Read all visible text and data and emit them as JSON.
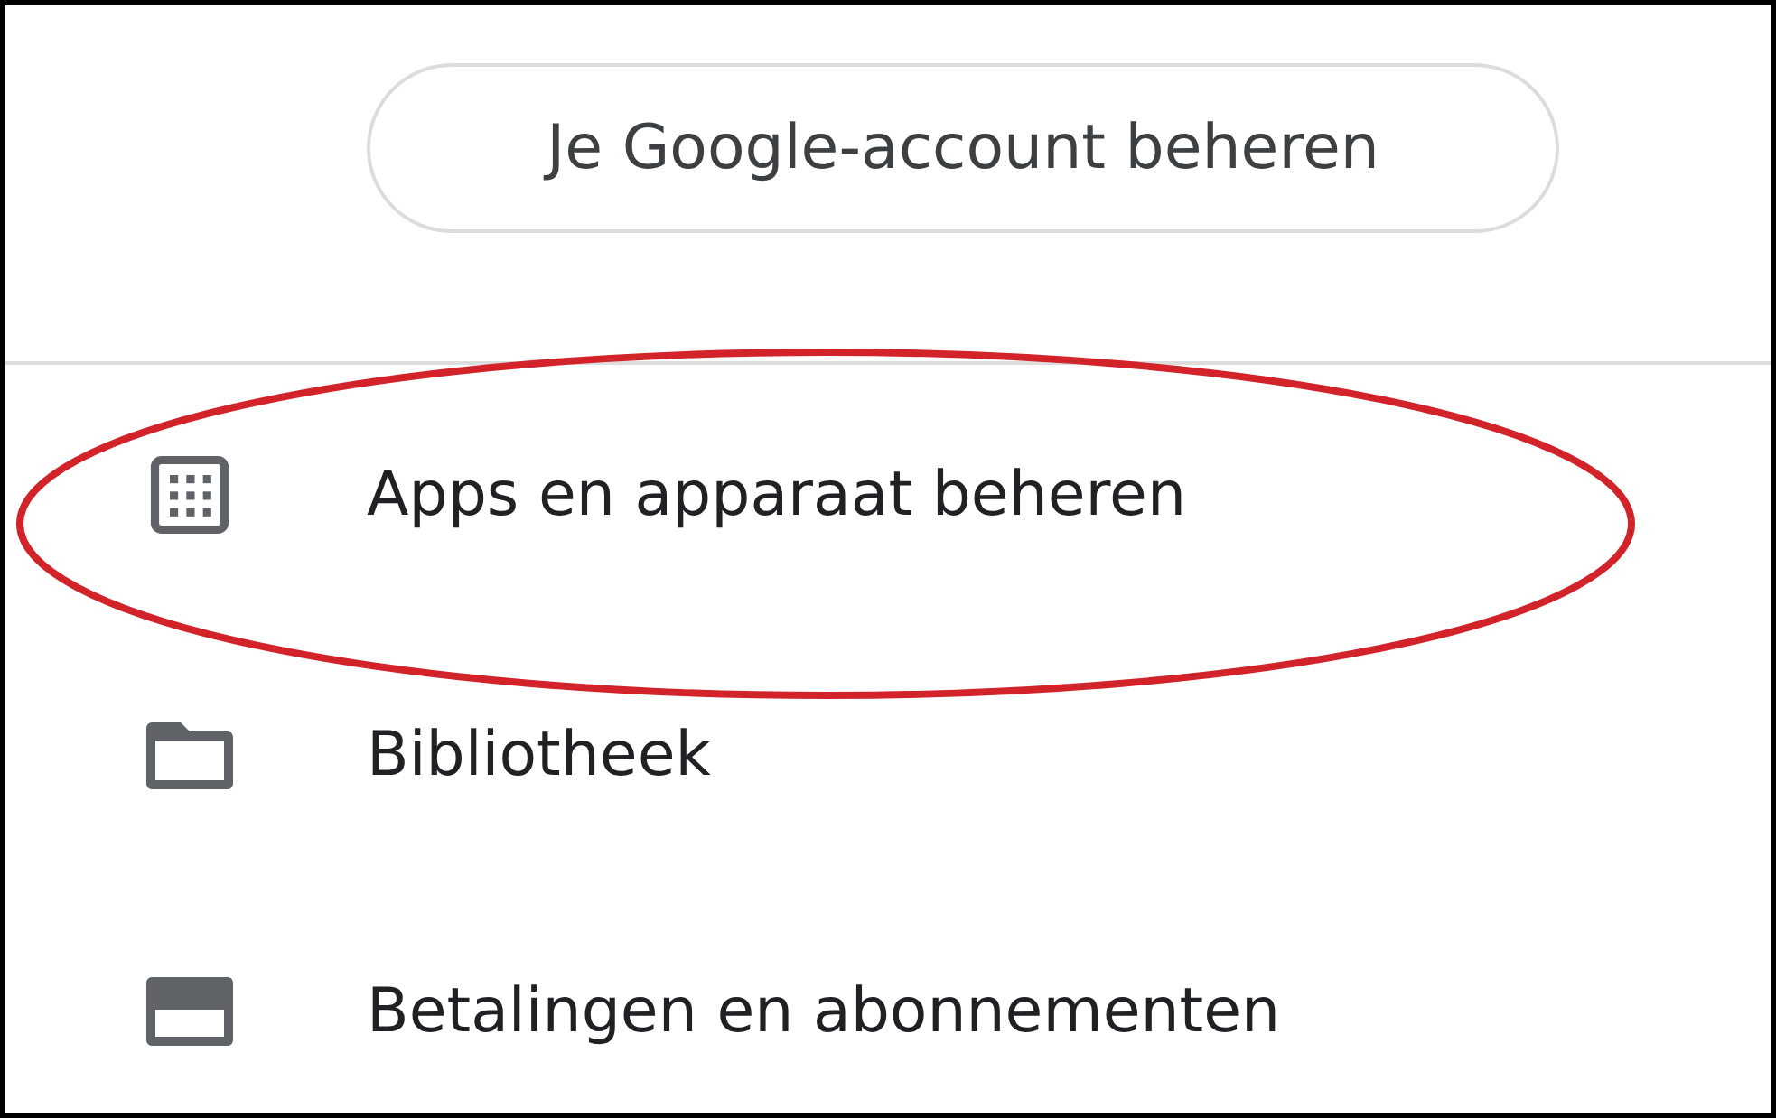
{
  "account_button": {
    "label": "Je Google-account beheren"
  },
  "menu": [
    {
      "kind": "apps",
      "label": "Apps en apparaat beheren",
      "highlighted": true
    },
    {
      "kind": "library",
      "label": "Bibliotheek",
      "highlighted": false
    },
    {
      "kind": "payments",
      "label": "Betalingen en abonnementen",
      "highlighted": false
    }
  ]
}
